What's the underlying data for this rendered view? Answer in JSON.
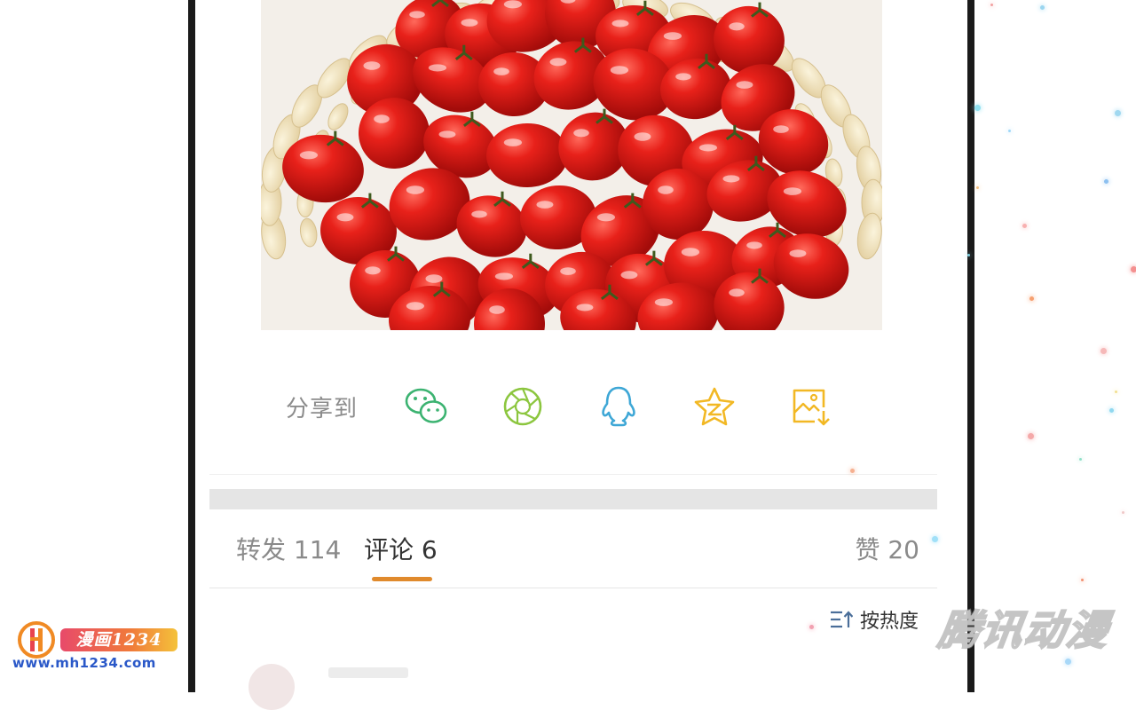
{
  "share": {
    "label": "分享到",
    "icons": [
      "wechat-icon",
      "moments-icon",
      "qq-icon",
      "qzone-icon",
      "save-image-icon"
    ]
  },
  "tabs": {
    "repost": "转发 114",
    "comment": "评论 6",
    "like": "赞 20"
  },
  "sort": {
    "label": "按热度"
  },
  "watermarks": {
    "site_tag": "漫画1234",
    "site_url": "www.mh1234.com",
    "brand": "腾讯动漫"
  },
  "colors": {
    "accent_underline": "#e08a2c",
    "wechat": "#3cb371",
    "moments": "#8cc63f",
    "qq": "#3ea7d6",
    "qzone": "#f2b824",
    "save": "#f2b824",
    "sort": "#4a6e99"
  }
}
